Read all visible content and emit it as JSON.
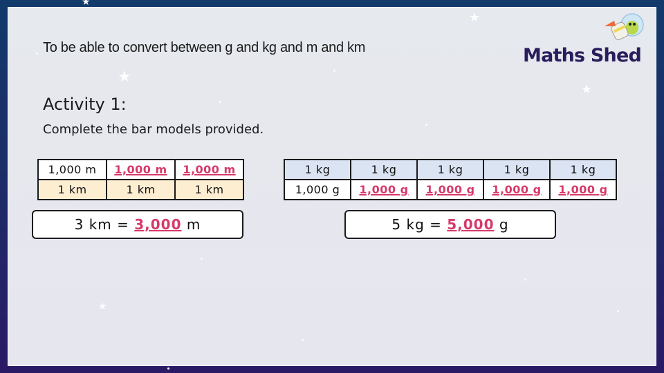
{
  "objective": "To be able to convert between g and kg and m and km",
  "logo": {
    "text": "Maths Shed",
    "mascot": "rocket-alien-mascot"
  },
  "activity": {
    "title": "Activity 1:",
    "instruction": "Complete the bar models provided."
  },
  "bar_model_metres": {
    "top_row": [
      {
        "text": "1,000 m",
        "is_answer": false
      },
      {
        "text": "1,000 m",
        "is_answer": true
      },
      {
        "text": "1,000 m",
        "is_answer": true
      }
    ],
    "bottom_row": [
      "1 km",
      "1 km",
      "1 km"
    ],
    "equation": {
      "left": "3 km = ",
      "answer": "3,000",
      "right": " m"
    }
  },
  "bar_model_grams": {
    "top_row": [
      "1 kg",
      "1 kg",
      "1 kg",
      "1 kg",
      "1 kg"
    ],
    "bottom_row": [
      {
        "text": "1,000 g",
        "is_answer": false
      },
      {
        "text": "1,000 g",
        "is_answer": true
      },
      {
        "text": "1,000 g",
        "is_answer": true
      },
      {
        "text": "1,000 g",
        "is_answer": true
      },
      {
        "text": "1,000 g",
        "is_answer": true
      }
    ],
    "equation": {
      "left": "5 kg = ",
      "answer": "5,000",
      "right": " g"
    }
  },
  "colors": {
    "answer": "#d63a6a",
    "km_row_fill": "#fdeed2",
    "kg_row_fill": "#dbe4f3",
    "logo_text": "#2a1d5c",
    "frame_top": "#123a6b",
    "frame_bottom": "#2a1a66"
  }
}
